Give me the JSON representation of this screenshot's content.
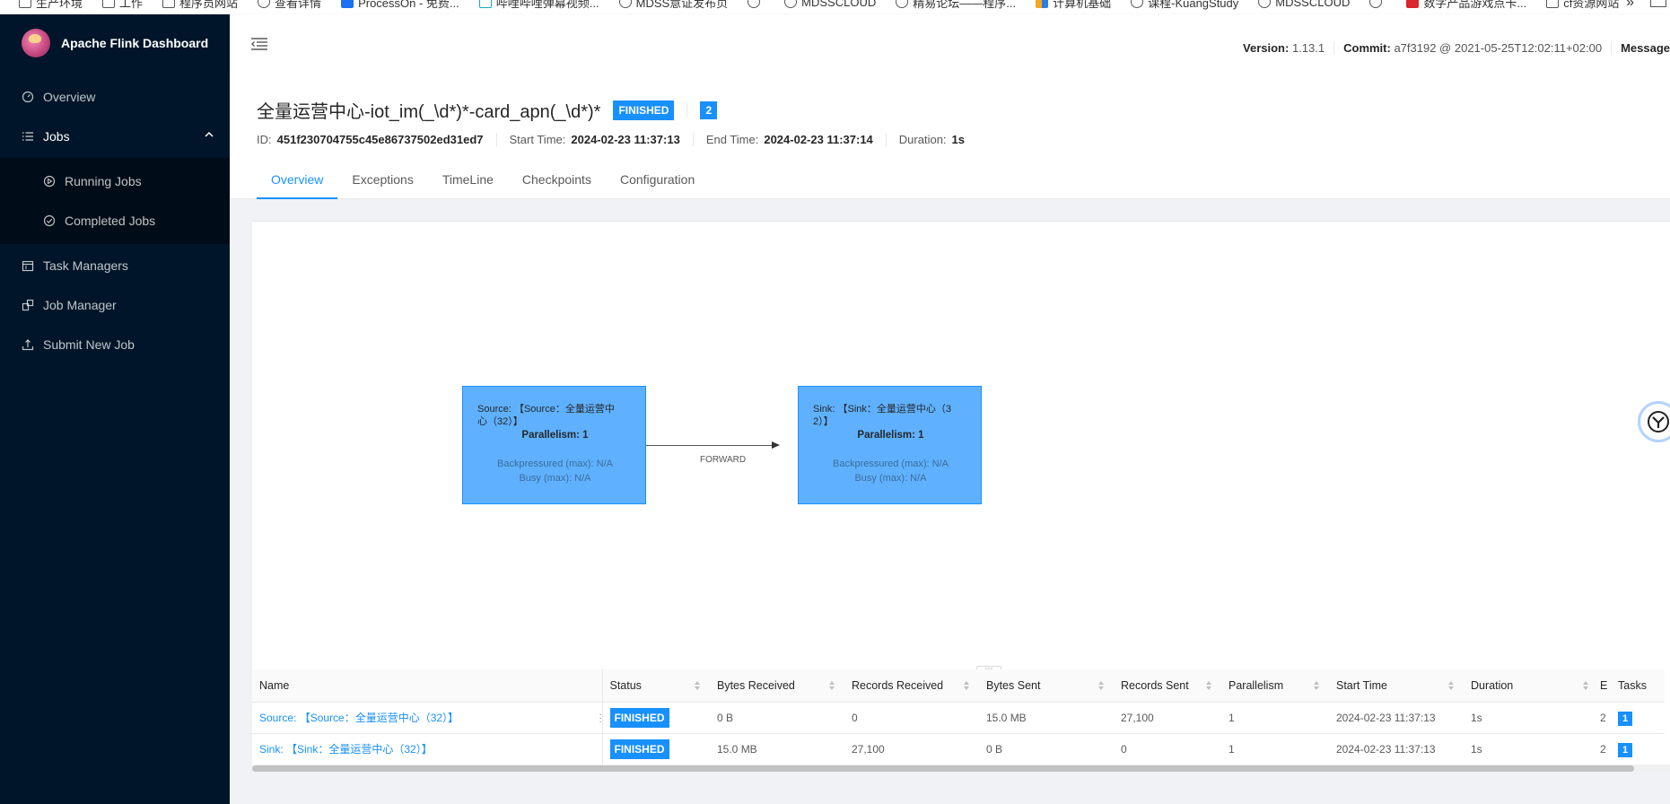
{
  "bookmarks": [
    {
      "label": "生产环境",
      "icon": "folder-icon"
    },
    {
      "label": "工作",
      "icon": "folder-icon"
    },
    {
      "label": "程序员网站",
      "icon": "folder-icon"
    },
    {
      "label": "查看详情",
      "icon": "globe-icon"
    },
    {
      "label": "ProcessOn - 免费...",
      "icon": "processon-icon"
    },
    {
      "label": "哔哩哔哩弹幕视频...",
      "icon": "bilibili-icon"
    },
    {
      "label": "MDSS意证发布页",
      "icon": "globe-icon"
    },
    {
      "label": "",
      "icon": "globe-icon"
    },
    {
      "label": "MDSSCLOUD",
      "icon": "globe-icon"
    },
    {
      "label": "精易论坛——程序...",
      "icon": "forum-icon"
    },
    {
      "label": "计算机基础",
      "icon": "windows-icon"
    },
    {
      "label": "课程-KuangStudy",
      "icon": "kuang-icon"
    },
    {
      "label": "MDSSCLOUD",
      "icon": "globe-icon"
    },
    {
      "label": "",
      "icon": "globe-icon"
    },
    {
      "label": "数字产品游戏点卡...",
      "icon": "red-icon"
    },
    {
      "label": "cf资源网站",
      "icon": "folder-icon"
    }
  ],
  "sidebar": {
    "title": "Apache Flink Dashboard",
    "items": [
      {
        "label": "Overview",
        "icon": "dashboard-icon"
      },
      {
        "label": "Jobs",
        "icon": "list-icon"
      },
      {
        "label": "Running Jobs",
        "icon": "play-circle-icon"
      },
      {
        "label": "Completed Jobs",
        "icon": "check-circle-icon"
      },
      {
        "label": "Task Managers",
        "icon": "schedule-icon"
      },
      {
        "label": "Job Manager",
        "icon": "build-icon"
      },
      {
        "label": "Submit New Job",
        "icon": "upload-icon"
      }
    ]
  },
  "header": {
    "version_label": "Version:",
    "version": "1.13.1",
    "commit_label": "Commit:",
    "commit": "a7f3192 @ 2021-05-25T12:02:11+02:00",
    "message_label": "Message"
  },
  "job": {
    "name": "全量运营中心-iot_im(_\\d*)*-card_apn(_\\d*)*",
    "status": "FINISHED",
    "status_count": "2",
    "id_label": "ID:",
    "id": "451f230704755c45e86737502ed31ed7",
    "start_label": "Start Time:",
    "start": "2024-02-23 11:37:13",
    "end_label": "End Time:",
    "end": "2024-02-23 11:37:14",
    "duration_label": "Duration:",
    "duration": "1s"
  },
  "tabs": [
    "Overview",
    "Exceptions",
    "TimeLine",
    "Checkpoints",
    "Configuration"
  ],
  "graph": {
    "nodes": [
      {
        "name_line1": "Source: 【Source：全量运营中",
        "name_line2": "心（32）】",
        "parallelism": "Parallelism: 1",
        "backpressure": "Backpressured (max): N/A",
        "busy": "Busy (max): N/A"
      },
      {
        "name_line1": "Sink: 【Sink：全量运营中心（3",
        "name_line2": "2）】",
        "parallelism": "Parallelism: 1",
        "backpressure": "Backpressured (max): N/A",
        "busy": "Busy (max): N/A"
      }
    ],
    "edge_label": "FORWARD",
    "resize_handle": "⋯"
  },
  "table": {
    "columns": [
      "Name",
      "Status",
      "Bytes Received",
      "Records Received",
      "Bytes Sent",
      "Records Sent",
      "Parallelism",
      "Start Time",
      "Duration",
      "E",
      "Tasks"
    ],
    "rows": [
      {
        "name": "Source: 【Source：全量运营中心（32）】",
        "status": "FINISHED",
        "bytes_received": "0 B",
        "records_received": "0",
        "bytes_sent": "15.0 MB",
        "records_sent": "27,100",
        "parallelism": "1",
        "start_time": "2024-02-23 11:37:13",
        "duration": "1s",
        "end": "2",
        "tasks": "1"
      },
      {
        "name": "Sink: 【Sink：全量运营中心（32）】",
        "status": "FINISHED",
        "bytes_received": "15.0 MB",
        "records_received": "27,100",
        "bytes_sent": "0 B",
        "records_sent": "0",
        "parallelism": "1",
        "start_time": "2024-02-23 11:37:13",
        "duration": "1s",
        "end": "2",
        "tasks": "1"
      }
    ]
  },
  "colors": {
    "primary": "#1890ff",
    "sider_bg": "#001529",
    "node_fill": "#5fb1ff"
  }
}
